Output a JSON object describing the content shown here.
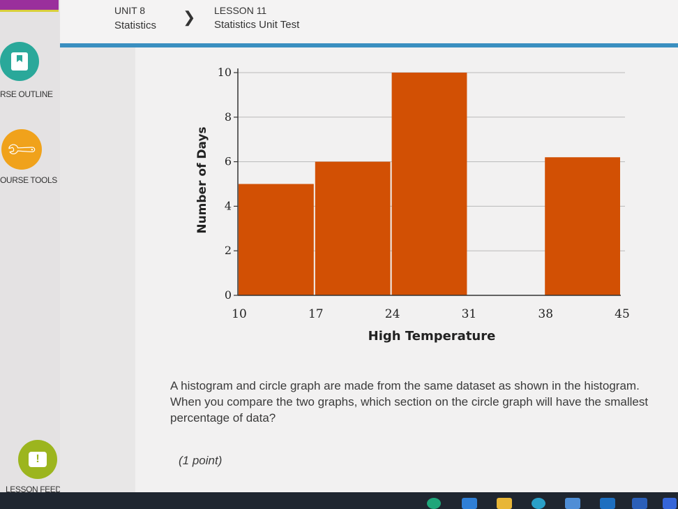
{
  "sidebar": {
    "items": [
      {
        "label": "RSE OUTLINE",
        "icon": "bookmark-icon",
        "color": "#2aa89a"
      },
      {
        "label": "OURSE TOOLS",
        "icon": "wrench-icon",
        "color": "#f0a21b"
      },
      {
        "label": "LESSON FEEDBACK",
        "icon": "exclamation-icon",
        "color": "#9cb51e"
      }
    ]
  },
  "header": {
    "unit": "UNIT 8",
    "unit_name": "Statistics",
    "lesson": "LESSON 11",
    "lesson_name": "Statistics Unit Test",
    "accent": "#3a8fc0"
  },
  "chart_data": {
    "type": "bar",
    "subtype": "histogram",
    "bin_edges": [
      10,
      17,
      24,
      31,
      38,
      45
    ],
    "categories": [
      "10-17",
      "17-24",
      "24-31",
      "31-38",
      "38-45"
    ],
    "values": [
      5,
      6,
      10,
      0,
      6.2
    ],
    "xlabel": "High Temperature",
    "ylabel": "Number of Days",
    "yticks": [
      0,
      2,
      4,
      6,
      8,
      10
    ],
    "xticks": [
      "10",
      "17",
      "24",
      "31",
      "38",
      "45"
    ],
    "ylim": [
      0,
      10
    ],
    "bar_color": "#d25004",
    "grid": true
  },
  "question": {
    "text": "A histogram and circle graph are made from the same dataset as shown in the histogram. When you compare the two graphs, which section on the circle graph will have the smallest percentage of data?",
    "points": "(1 point)"
  }
}
